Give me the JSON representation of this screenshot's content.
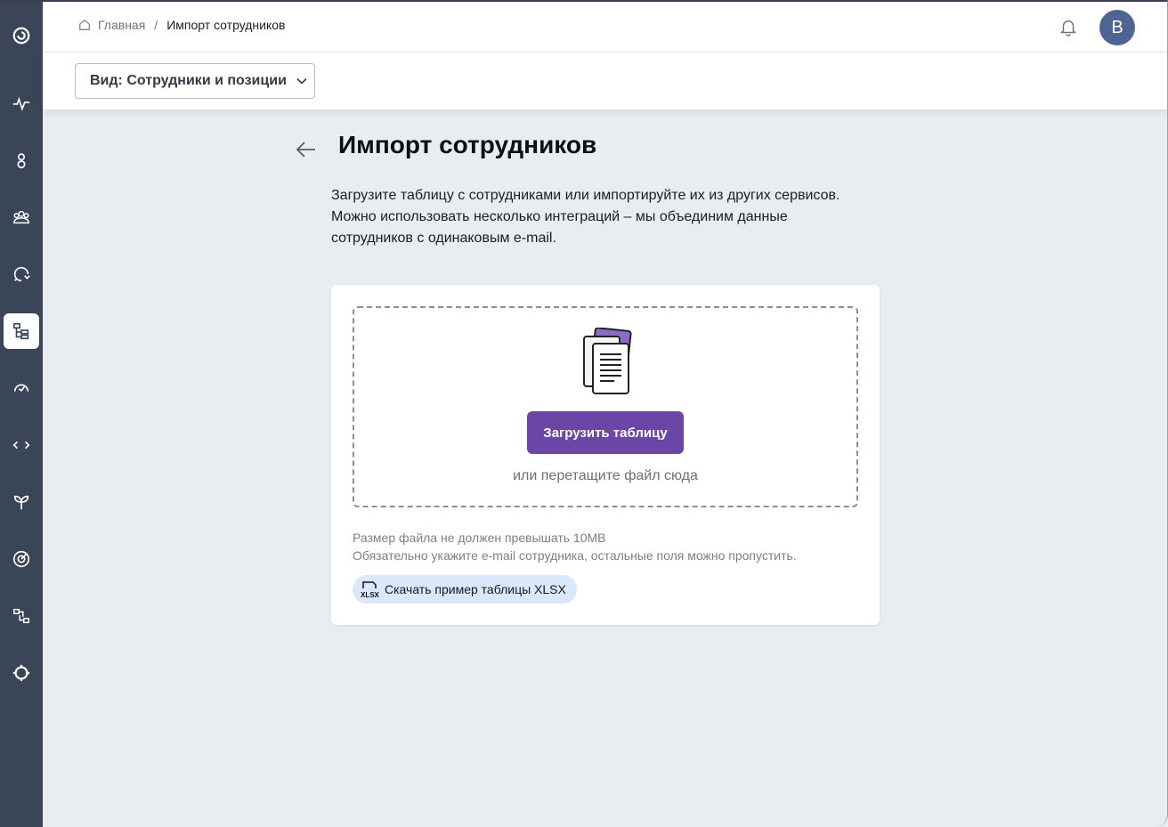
{
  "sidebar": {
    "items": [
      {
        "icon": "logo-spiral-icon"
      },
      {
        "icon": "pulse-icon"
      },
      {
        "icon": "person-icon"
      },
      {
        "icon": "team-icon"
      },
      {
        "icon": "chat-refresh-icon"
      },
      {
        "icon": "org-structure-icon",
        "active": true
      },
      {
        "icon": "speedometer-icon"
      },
      {
        "icon": "code-arrows-icon"
      },
      {
        "icon": "sprout-icon"
      },
      {
        "icon": "target-icon"
      },
      {
        "icon": "integration-icon"
      },
      {
        "icon": "gear-icon"
      }
    ]
  },
  "header": {
    "breadcrumb_home": "Главная",
    "breadcrumb_separator": "/",
    "breadcrumb_current": "Импорт сотрудников",
    "avatar_initial": "B"
  },
  "viewbar": {
    "view_label": "Вид: Сотрудники и позиции"
  },
  "main": {
    "title": "Импорт сотрудников",
    "intro_line1": "Загрузите таблицу с сотрудниками или импортируйте их из других сервисов.",
    "intro_line2": "Можно использовать несколько интеграций – мы объединим данные",
    "intro_line3": "сотрудников с одинаковым e-mail.",
    "upload_button": "Загрузить таблицу",
    "drop_hint": "или перетащите файл сюда",
    "hint_size": "Размер файла не должен превышать 10MB",
    "hint_email": "Обязательно укажите e-mail сотрудника, остальные поля можно пропустить.",
    "download_label": "Скачать пример таблицы XLSX"
  },
  "colors": {
    "sidebar_bg": "#3a4558",
    "accent": "#6b46a6",
    "avatar_bg": "#4e6594",
    "chip_bg": "#dbe7fb",
    "page_bg": "#e9edf2"
  }
}
